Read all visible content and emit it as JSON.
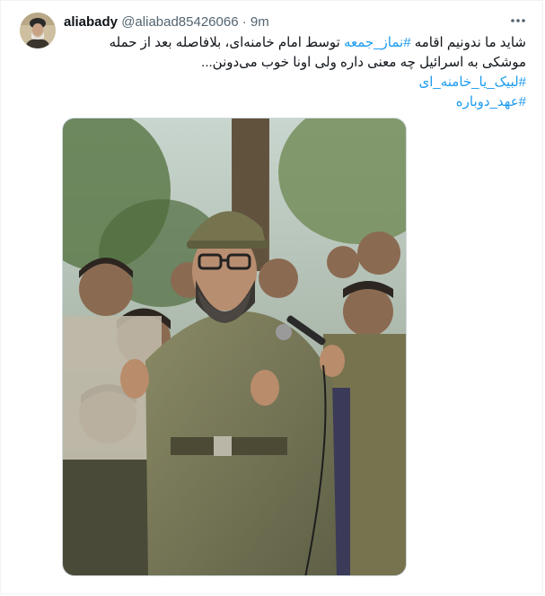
{
  "tweet": {
    "author_name": "aliabady",
    "author_handle": "@aliabad85426066",
    "separator": "·",
    "time": "9m",
    "text": {
      "line1_before": "شاید ما ندونیم اقامه ",
      "line1_hashtag": "#نماز_جمعه",
      "line1_after": " توسط امام خامنه‌ای، بلافاصله بعد از حمله",
      "line2": "موشکی به اسرائیل چه معنی داره ولی اونا خوب می‌دونن...",
      "hashtag_1": "#لبیک_یا_خامنه_ای",
      "hashtag_2": "#عهد_دوباره"
    }
  },
  "icons": {
    "more": "more-horizontal-icon"
  },
  "colors": {
    "link": "#1d9bf0",
    "text": "#0f1419",
    "muted": "#536471",
    "border": "#cfd9de"
  }
}
